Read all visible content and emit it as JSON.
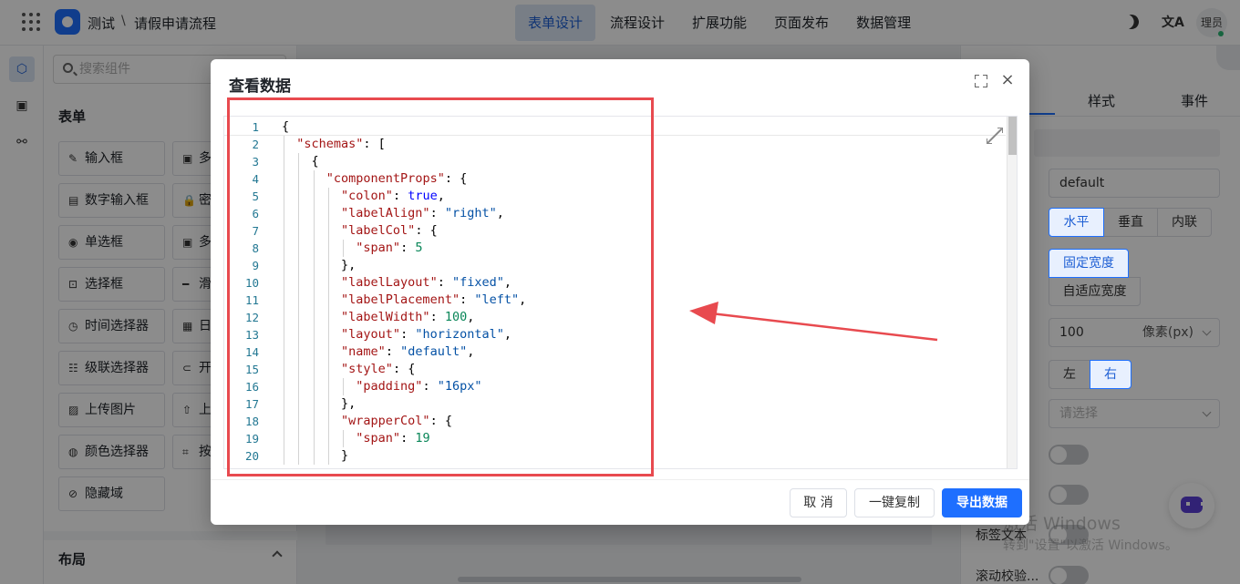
{
  "header": {
    "app_name": "测试",
    "separator": "\\",
    "page_name": "请假申请流程",
    "tabs": [
      {
        "label": "表单设计",
        "active": true
      },
      {
        "label": "流程设计",
        "active": false
      },
      {
        "label": "扩展功能",
        "active": false
      },
      {
        "label": "页面发布",
        "active": false
      },
      {
        "label": "数据管理",
        "active": false
      }
    ],
    "translate_glyph": "文A",
    "user": "理员",
    "accent": "#1e6fff"
  },
  "sidebar": {
    "search_placeholder": "搜索组件",
    "form_section": "表单",
    "layout_section": "布局",
    "components": [
      {
        "label": "输入框",
        "icon": "✎"
      },
      {
        "label": "多",
        "icon": "▣"
      },
      {
        "label": "数字输入框",
        "icon": "▤"
      },
      {
        "label": "密",
        "icon": "🔒"
      },
      {
        "label": "单选框",
        "icon": "◉"
      },
      {
        "label": "多",
        "icon": "▣"
      },
      {
        "label": "选择框",
        "icon": "⊡"
      },
      {
        "label": "滑",
        "icon": "━"
      },
      {
        "label": "时间选择器",
        "icon": "◷"
      },
      {
        "label": "日",
        "icon": "▦"
      },
      {
        "label": "级联选择器",
        "icon": "☷"
      },
      {
        "label": "开",
        "icon": "⊂"
      },
      {
        "label": "上传图片",
        "icon": "▨"
      },
      {
        "label": "上",
        "icon": "⇧"
      },
      {
        "label": "颜色选择器",
        "icon": "◍"
      },
      {
        "label": "按",
        "icon": "⌗"
      },
      {
        "label": "隐藏域",
        "icon": "⊘"
      }
    ]
  },
  "props": {
    "tabs": [
      "样式",
      "事件"
    ],
    "name_value": "default",
    "layout_options": [
      "水平",
      "垂直",
      "内联"
    ],
    "width_options": [
      "固定宽度",
      "自适应宽度"
    ],
    "label_width": "100",
    "label_width_unit": "像素(px)",
    "align_options": [
      "左",
      "右"
    ],
    "select_placeholder": "请选择",
    "label_text": "标签文本",
    "scroll_label": "滚动校验...",
    "watermark_line1": "激活 Windows",
    "watermark_line2": "转到\"设置\"以激活 Windows。"
  },
  "modal": {
    "title": "查看数据",
    "cancel_label": "取 消",
    "copy_label": "一键复制",
    "export_label": "导出数据",
    "code_lines": [
      "{",
      "  \"schemas\": [",
      "    {",
      "      \"componentProps\": {",
      "        \"colon\": true,",
      "        \"labelAlign\": \"right\",",
      "        \"labelCol\": {",
      "          \"span\": 5",
      "        },",
      "        \"labelLayout\": \"fixed\",",
      "        \"labelPlacement\": \"left\",",
      "        \"labelWidth\": 100,",
      "        \"layout\": \"horizontal\",",
      "        \"name\": \"default\",",
      "        \"style\": {",
      "          \"padding\": \"16px\"",
      "        },",
      "        \"wrapperCol\": {",
      "          \"span\": 19",
      "        }"
    ]
  }
}
